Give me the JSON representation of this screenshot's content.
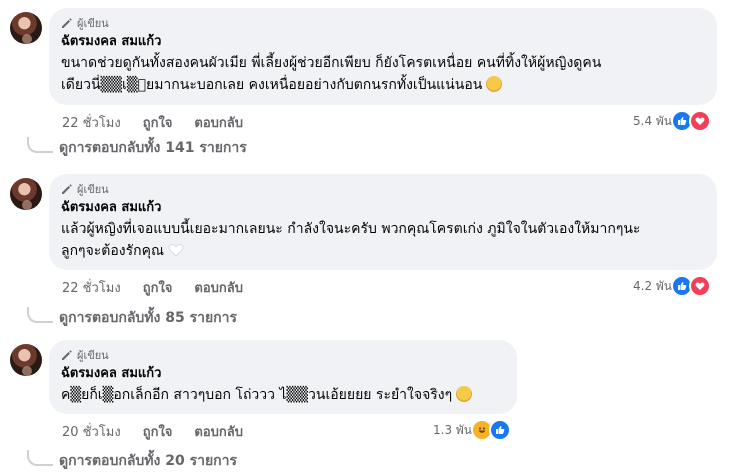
{
  "comments": [
    {
      "badge": "ผู้เขียน",
      "name": "ฉัตรมงคล สมแก้ว",
      "text": "ขนาดช่วยดูกันทั้งสองคนผัวเมีย พี่เลี้ยงผู้ช่วยอีกเพียบ ก็ยังโครตเหนื่อย คนที่ทิ้งให้ผู้หญิงดูคน\nเดียวนี่▒▒เ▒้ยมากนะบอกเลย คงเหนื่อยอย่างกับตกนรกทั้งเป็นแน่นอน",
      "emoji": "dizzy-face-emoji",
      "time": "22 ชั่วโมง",
      "like": "ถูกใจ",
      "reply": "ตอบกลับ",
      "reaction_count": "5.4 พัน",
      "reactions": [
        "like",
        "love"
      ],
      "view_replies": "ดูการตอบกลับทั้ง 141 รายการ"
    },
    {
      "badge": "ผู้เขียน",
      "name": "ฉัตรมงคล สมแก้ว",
      "text": "แล้วผู้หญิงที่เจอแบบนี้เยอะมากเลยนะ กำลังใจนะครับ พวกคุณโครตเก่ง ภูมิใจในตัวเองให้มากๆนะ\nลูกๆจะต้องรักคุณ",
      "emoji": "white-heart-emoji",
      "time": "22 ชั่วโมง",
      "like": "ถูกใจ",
      "reply": "ตอบกลับ",
      "reaction_count": "4.2 พัน",
      "reactions": [
        "like",
        "love"
      ],
      "view_replies": "ดูการตอบกลับทั้ง 85 รายการ"
    },
    {
      "badge": "ผู้เขียน",
      "name": "ฉัตรมงคล สมแก้ว",
      "text": "ค▒ยก็เ▒อกเล็กอีก สาวๆบอก โถ่ววว ไ▒▒วนเอ้ยยยย ระยำใจจริงๆ",
      "emoji": "rolling-laughing-emoji",
      "time": "20 ชั่วโมง",
      "like": "ถูกใจ",
      "reply": "ตอบกลับ",
      "reaction_count": "1.3 พัน",
      "reactions": [
        "haha",
        "like"
      ],
      "view_replies": "ดูการตอบกลับทั้ง 20 รายการ"
    }
  ]
}
